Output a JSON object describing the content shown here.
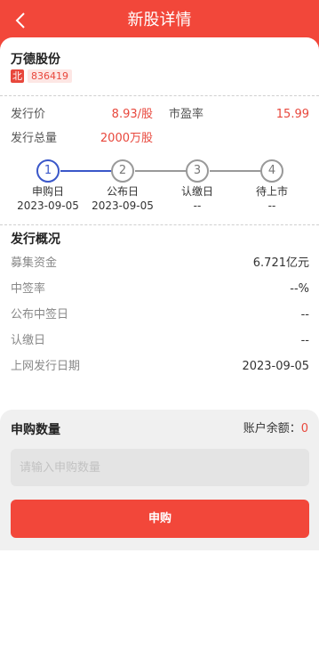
{
  "header": {
    "title": "新股详情"
  },
  "stock": {
    "name": "万德股份",
    "exchange_badge": "北",
    "code": "836419"
  },
  "summary": {
    "issue_price_label": "发行价",
    "issue_price_value": "8.93/股",
    "pe_label": "市盈率",
    "pe_value": "15.99",
    "total_issue_label": "发行总量",
    "total_issue_value": "2000万股"
  },
  "steps": [
    {
      "num": "1",
      "label": "申购日",
      "date": "2023-09-05",
      "active": true
    },
    {
      "num": "2",
      "label": "公布日",
      "date": "2023-09-05",
      "active": false
    },
    {
      "num": "3",
      "label": "认缴日",
      "date": "--",
      "active": false
    },
    {
      "num": "4",
      "label": "待上市",
      "date": "--",
      "active": false
    }
  ],
  "overview": {
    "title": "发行概况",
    "rows": [
      {
        "label": "募集资金",
        "value": "6.721亿元"
      },
      {
        "label": "中签率",
        "value": "--%"
      },
      {
        "label": "公布中签日",
        "value": "--"
      },
      {
        "label": "认缴日",
        "value": "--"
      },
      {
        "label": "上网发行日期",
        "value": "2023-09-05"
      }
    ]
  },
  "subscribe": {
    "title": "申购数量",
    "balance_label": "账户余额：",
    "balance_value": "0",
    "input_placeholder": "请输入申购数量",
    "submit_label": "申购"
  },
  "colors": {
    "brand_red": "#f2473a",
    "step_active": "#3a57c9"
  }
}
